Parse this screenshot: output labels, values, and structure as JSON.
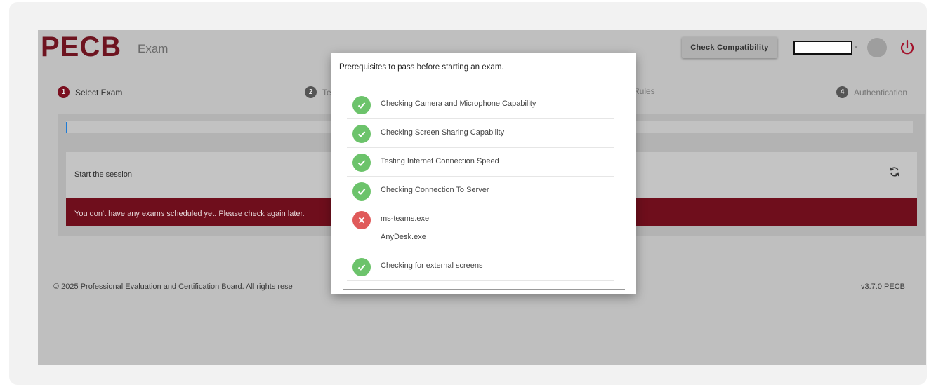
{
  "header": {
    "logo": "PECB",
    "logo_sub": "Exam",
    "check_compatibility": "Check Compatibility",
    "user_menu_icon": "chevron-down-icon",
    "power_icon": "power-icon"
  },
  "steps": [
    {
      "num": "1",
      "label": "Select Exam",
      "active": true
    },
    {
      "num": "2",
      "label": "Te",
      "active": false
    },
    {
      "num": "",
      "label": "Rules",
      "active": false
    },
    {
      "num": "4",
      "label": "Authentication",
      "active": false
    }
  ],
  "main": {
    "session_title": "Start the session",
    "refresh_icon": "refresh-icon",
    "alert": "You don't have any exams scheduled yet. Please check again later."
  },
  "footer": {
    "copyright": "© 2025 Professional Evaluation and Certification Board. All rights rese",
    "version": "v3.7.0 PECB"
  },
  "modal": {
    "title": "Prerequisites to pass before starting an exam.",
    "checks": [
      {
        "label": "Checking Camera and Microphone Capability",
        "status": "ok"
      },
      {
        "label": "Checking Screen Sharing Capability",
        "status": "ok"
      },
      {
        "label": "Testing Internet Connection Speed",
        "status": "ok"
      },
      {
        "label": "Checking Connection To Server",
        "status": "ok"
      },
      {
        "label": "ms-teams.exe",
        "sub": "AnyDesk.exe",
        "status": "fail"
      },
      {
        "label": "Checking for external screens",
        "status": "ok"
      }
    ]
  },
  "colors": {
    "brand": "#6e1420",
    "alert_bg": "#6f0e1c",
    "ok": "#6cc36b",
    "fail": "#e05a5a"
  }
}
